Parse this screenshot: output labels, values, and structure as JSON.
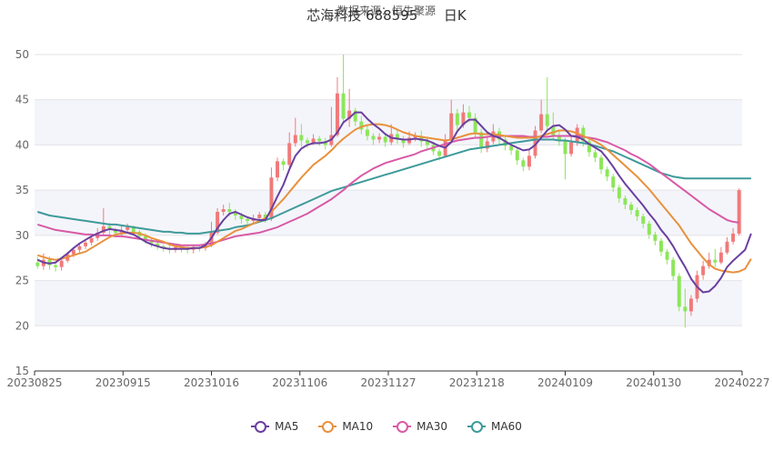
{
  "title": "芯海科技 688595      日K",
  "source": "数据来源：恒生聚源",
  "chart_data": {
    "type": "candlestick",
    "y_axis": {
      "min": 15,
      "max": 50,
      "ticks": [
        15,
        20,
        25,
        30,
        35,
        40,
        45,
        50
      ]
    },
    "x_tick_labels": [
      "20230825",
      "20230915",
      "20231016",
      "20231106",
      "20231127",
      "20231218",
      "20240109",
      "20240130",
      "20240227"
    ],
    "colors": {
      "up": "#f07a7a",
      "down": "#8ce65a",
      "ma5": "#6a3fa0",
      "ma10": "#e8913d",
      "ma30": "#d85aa6",
      "ma60": "#3e9a9a"
    },
    "candles": [
      [
        27.0,
        26.6,
        27.6,
        26.3
      ],
      [
        26.6,
        27.3,
        28.0,
        26.2
      ],
      [
        27.3,
        26.7,
        27.7,
        26.2
      ],
      [
        26.7,
        26.5,
        27.1,
        26.0
      ],
      [
        26.5,
        27.2,
        27.5,
        26.1
      ],
      [
        27.2,
        27.9,
        28.2,
        27.0
      ],
      [
        27.9,
        28.4,
        28.7,
        27.6
      ],
      [
        28.4,
        28.8,
        29.2,
        28.1
      ],
      [
        28.8,
        29.2,
        29.6,
        28.5
      ],
      [
        29.2,
        29.7,
        30.0,
        28.9
      ],
      [
        29.7,
        30.3,
        30.8,
        29.4
      ],
      [
        30.3,
        31.0,
        33.0,
        30.0
      ],
      [
        31.0,
        30.6,
        31.4,
        30.1
      ],
      [
        30.6,
        30.3,
        30.8,
        29.8
      ],
      [
        30.3,
        30.6,
        31.0,
        30.0
      ],
      [
        30.6,
        30.9,
        31.3,
        30.4
      ],
      [
        30.9,
        30.4,
        31.1,
        30.0
      ],
      [
        30.4,
        29.9,
        30.6,
        29.5
      ],
      [
        29.9,
        29.4,
        30.2,
        29.1
      ],
      [
        29.4,
        29.1,
        29.7,
        28.7
      ],
      [
        29.1,
        28.8,
        29.3,
        28.4
      ],
      [
        28.8,
        28.6,
        29.0,
        28.2
      ],
      [
        28.6,
        28.4,
        28.9,
        28.0
      ],
      [
        28.4,
        28.7,
        29.0,
        28.1
      ],
      [
        28.7,
        28.5,
        28.9,
        28.1
      ],
      [
        28.5,
        28.4,
        28.8,
        28.0
      ],
      [
        28.4,
        28.7,
        29.0,
        28.0
      ],
      [
        28.7,
        28.6,
        29.0,
        28.2
      ],
      [
        28.6,
        28.9,
        29.3,
        28.3
      ],
      [
        28.9,
        30.3,
        31.5,
        28.7
      ],
      [
        30.3,
        32.6,
        33.0,
        30.1
      ],
      [
        32.6,
        32.9,
        33.4,
        32.2
      ],
      [
        32.9,
        32.6,
        33.6,
        32.1
      ],
      [
        32.6,
        32.2,
        32.9,
        31.7
      ],
      [
        32.2,
        31.8,
        32.5,
        31.3
      ],
      [
        31.8,
        31.6,
        32.1,
        31.1
      ],
      [
        31.6,
        31.9,
        32.3,
        31.3
      ],
      [
        31.9,
        32.3,
        32.6,
        31.6
      ],
      [
        32.3,
        31.8,
        32.6,
        31.4
      ],
      [
        31.8,
        36.4,
        37.5,
        31.6
      ],
      [
        36.4,
        38.2,
        38.6,
        36.0
      ],
      [
        38.2,
        37.8,
        38.5,
        37.2
      ],
      [
        37.8,
        40.2,
        41.4,
        37.5
      ],
      [
        40.2,
        41.1,
        43.0,
        39.8
      ],
      [
        41.1,
        40.5,
        42.3,
        39.8
      ],
      [
        40.5,
        40.2,
        40.8,
        39.7
      ],
      [
        40.2,
        40.7,
        41.2,
        40.0
      ],
      [
        40.7,
        40.4,
        41.0,
        39.9
      ],
      [
        40.4,
        40.0,
        40.8,
        39.5
      ],
      [
        40.0,
        41.1,
        44.2,
        39.8
      ],
      [
        41.1,
        45.7,
        47.5,
        40.9
      ],
      [
        45.7,
        42.9,
        50.0,
        42.4
      ],
      [
        42.9,
        43.8,
        46.2,
        42.0
      ],
      [
        43.8,
        42.6,
        44.1,
        42.1
      ],
      [
        42.6,
        41.7,
        43.2,
        41.2
      ],
      [
        41.7,
        41.0,
        42.1,
        40.5
      ],
      [
        41.0,
        40.6,
        41.3,
        40.0
      ],
      [
        40.6,
        40.9,
        41.3,
        40.2
      ],
      [
        40.9,
        40.3,
        41.2,
        39.8
      ],
      [
        40.3,
        41.2,
        42.3,
        40.0
      ],
      [
        41.2,
        40.6,
        41.7,
        40.1
      ],
      [
        40.6,
        40.2,
        41.0,
        39.7
      ],
      [
        40.2,
        40.8,
        41.5,
        40.0
      ],
      [
        40.8,
        41.0,
        41.4,
        40.4
      ],
      [
        41.0,
        40.4,
        41.6,
        39.8
      ],
      [
        40.4,
        40.0,
        40.8,
        39.5
      ],
      [
        40.0,
        39.3,
        40.4,
        38.9
      ],
      [
        39.3,
        38.8,
        39.6,
        38.3
      ],
      [
        38.8,
        40.5,
        41.2,
        38.6
      ],
      [
        40.5,
        43.5,
        45.0,
        40.3
      ],
      [
        43.5,
        42.2,
        44.0,
        41.6
      ],
      [
        42.2,
        43.6,
        44.5,
        41.9
      ],
      [
        43.6,
        43.0,
        44.3,
        42.5
      ],
      [
        43.0,
        41.4,
        43.5,
        40.8
      ],
      [
        41.4,
        39.6,
        41.8,
        39.1
      ],
      [
        39.6,
        40.4,
        41.0,
        39.2
      ],
      [
        40.4,
        41.5,
        42.3,
        40.1
      ],
      [
        41.5,
        40.6,
        41.9,
        40.1
      ],
      [
        40.6,
        39.9,
        41.0,
        39.4
      ],
      [
        39.9,
        39.4,
        40.3,
        38.9
      ],
      [
        39.4,
        38.3,
        39.7,
        37.8
      ],
      [
        38.3,
        37.6,
        38.6,
        37.1
      ],
      [
        37.6,
        38.8,
        39.4,
        37.2
      ],
      [
        38.8,
        41.6,
        42.1,
        38.5
      ],
      [
        41.6,
        43.4,
        45.0,
        41.3
      ],
      [
        43.4,
        42.1,
        47.5,
        41.6
      ],
      [
        42.1,
        41.0,
        43.6,
        40.5
      ],
      [
        41.0,
        40.5,
        41.5,
        39.9
      ],
      [
        40.5,
        39.0,
        40.8,
        36.2
      ],
      [
        39.0,
        40.3,
        40.9,
        38.7
      ],
      [
        40.3,
        41.9,
        42.3,
        39.9
      ],
      [
        41.9,
        40.4,
        42.2,
        39.8
      ],
      [
        40.4,
        39.2,
        40.7,
        38.7
      ],
      [
        39.2,
        38.6,
        39.5,
        38.1
      ],
      [
        38.6,
        37.3,
        38.9,
        36.8
      ],
      [
        37.3,
        36.5,
        37.6,
        36.0
      ],
      [
        36.5,
        35.3,
        36.8,
        34.8
      ],
      [
        35.3,
        34.1,
        35.6,
        33.6
      ],
      [
        34.1,
        33.4,
        34.4,
        32.9
      ],
      [
        33.4,
        32.8,
        33.7,
        32.3
      ],
      [
        32.8,
        32.1,
        33.1,
        31.6
      ],
      [
        32.1,
        31.3,
        32.4,
        30.8
      ],
      [
        31.3,
        30.1,
        31.6,
        29.6
      ],
      [
        30.1,
        29.4,
        30.4,
        28.9
      ],
      [
        29.4,
        28.2,
        29.7,
        27.7
      ],
      [
        28.2,
        27.3,
        28.5,
        26.8
      ],
      [
        27.3,
        25.5,
        27.6,
        25.0
      ],
      [
        25.5,
        22.1,
        25.8,
        21.6
      ],
      [
        22.1,
        21.6,
        24.1,
        19.8
      ],
      [
        21.6,
        23.0,
        23.4,
        21.1
      ],
      [
        23.0,
        25.6,
        26.1,
        22.6
      ],
      [
        25.6,
        26.6,
        27.2,
        25.1
      ],
      [
        26.6,
        27.3,
        28.1,
        26.3
      ],
      [
        27.3,
        27.0,
        28.5,
        26.5
      ],
      [
        27.0,
        28.1,
        28.7,
        26.8
      ],
      [
        28.1,
        29.3,
        29.8,
        27.9
      ],
      [
        29.3,
        30.2,
        30.8,
        29.0
      ],
      [
        30.2,
        35.0,
        35.2,
        30.0
      ]
    ],
    "ma5": [
      27.3,
      27.0,
      26.9,
      27.0,
      27.5,
      28.0,
      28.6,
      29.1,
      29.5,
      29.9,
      30.2,
      30.5,
      30.7,
      30.6,
      30.5,
      30.3,
      30.1,
      29.7,
      29.3,
      29.0,
      28.8,
      28.6,
      28.5,
      28.5,
      28.5,
      28.5,
      28.6,
      28.6,
      28.9,
      29.7,
      30.8,
      31.7,
      32.4,
      32.6,
      32.3,
      32.0,
      31.8,
      31.7,
      31.7,
      32.9,
      34.3,
      35.6,
      37.3,
      38.8,
      39.6,
      40.0,
      40.2,
      40.2,
      40.3,
      40.6,
      41.4,
      42.5,
      43.0,
      43.6,
      43.6,
      42.9,
      42.3,
      41.8,
      41.2,
      40.8,
      40.7,
      40.6,
      40.6,
      40.7,
      40.6,
      40.5,
      40.2,
      39.9,
      39.7,
      40.3,
      41.5,
      42.3,
      42.8,
      42.8,
      42.1,
      41.4,
      41.0,
      40.8,
      40.4,
      40.0,
      39.7,
      39.4,
      39.5,
      40.0,
      40.8,
      41.6,
      42.1,
      42.2,
      41.7,
      41.0,
      40.9,
      40.6,
      40.1,
      39.7,
      39.3,
      38.5,
      37.6,
      36.6,
      35.7,
      34.9,
      34.1,
      33.3,
      32.4,
      31.6,
      30.6,
      29.8,
      28.8,
      27.6,
      26.5,
      25.2,
      24.3,
      23.7,
      23.8,
      24.4,
      25.3,
      26.5,
      27.2,
      27.8,
      28.4,
      30.2
    ],
    "ma10": [
      27.8,
      27.6,
      27.4,
      27.3,
      27.4,
      27.6,
      27.8,
      28.0,
      28.2,
      28.6,
      29.0,
      29.4,
      29.8,
      30.1,
      30.2,
      30.3,
      30.3,
      30.2,
      30.0,
      29.7,
      29.5,
      29.3,
      29.0,
      28.8,
      28.7,
      28.6,
      28.6,
      28.6,
      28.7,
      28.9,
      29.3,
      29.7,
      30.1,
      30.5,
      30.7,
      31.0,
      31.3,
      31.6,
      31.9,
      32.6,
      33.3,
      34.0,
      34.8,
      35.6,
      36.4,
      37.1,
      37.8,
      38.3,
      38.8,
      39.4,
      40.1,
      40.7,
      41.2,
      41.7,
      42.0,
      42.2,
      42.3,
      42.3,
      42.2,
      42.0,
      41.7,
      41.4,
      41.2,
      41.0,
      40.9,
      40.8,
      40.7,
      40.6,
      40.5,
      40.6,
      40.8,
      41.0,
      41.2,
      41.3,
      41.2,
      41.2,
      41.2,
      41.1,
      41.0,
      40.9,
      40.8,
      40.8,
      40.8,
      40.8,
      41.0,
      41.2,
      41.4,
      41.6,
      41.6,
      41.5,
      41.3,
      41.0,
      40.7,
      40.4,
      40.0,
      39.5,
      38.9,
      38.3,
      37.7,
      37.1,
      36.5,
      35.8,
      35.1,
      34.3,
      33.5,
      32.7,
      31.9,
      31.1,
      30.1,
      29.1,
      28.3,
      27.5,
      26.8,
      26.3,
      26.1,
      26.0,
      25.9,
      26.0,
      26.3,
      27.4
    ],
    "ma30": [
      31.2,
      31.0,
      30.8,
      30.6,
      30.5,
      30.4,
      30.3,
      30.2,
      30.1,
      30.1,
      30.0,
      30.0,
      30.0,
      29.9,
      29.9,
      29.8,
      29.7,
      29.6,
      29.5,
      29.4,
      29.3,
      29.2,
      29.1,
      29.0,
      28.9,
      28.9,
      28.9,
      28.9,
      29.0,
      29.1,
      29.3,
      29.5,
      29.7,
      29.9,
      30.0,
      30.1,
      30.2,
      30.3,
      30.5,
      30.7,
      30.9,
      31.2,
      31.5,
      31.8,
      32.1,
      32.4,
      32.8,
      33.2,
      33.6,
      34.0,
      34.5,
      35.0,
      35.6,
      36.1,
      36.6,
      37.0,
      37.4,
      37.7,
      38.0,
      38.2,
      38.4,
      38.6,
      38.8,
      39.0,
      39.3,
      39.5,
      39.7,
      39.9,
      40.1,
      40.3,
      40.5,
      40.6,
      40.7,
      40.8,
      40.8,
      40.9,
      41.0,
      41.0,
      41.0,
      41.0,
      41.0,
      41.0,
      40.9,
      40.9,
      40.9,
      40.9,
      41.0,
      41.0,
      41.0,
      41.0,
      41.0,
      40.9,
      40.8,
      40.7,
      40.5,
      40.3,
      40.0,
      39.7,
      39.4,
      39.0,
      38.7,
      38.3,
      37.9,
      37.4,
      36.9,
      36.4,
      35.9,
      35.4,
      34.9,
      34.4,
      33.9,
      33.4,
      32.9,
      32.5,
      32.1,
      31.7,
      31.5,
      31.4
    ],
    "ma60": [
      32.6,
      32.4,
      32.2,
      32.1,
      32.0,
      31.9,
      31.8,
      31.7,
      31.6,
      31.5,
      31.4,
      31.3,
      31.2,
      31.2,
      31.1,
      31.0,
      30.9,
      30.8,
      30.7,
      30.6,
      30.5,
      30.4,
      30.4,
      30.3,
      30.3,
      30.2,
      30.2,
      30.2,
      30.3,
      30.4,
      30.5,
      30.6,
      30.7,
      30.9,
      31.0,
      31.1,
      31.3,
      31.5,
      31.7,
      31.9,
      32.2,
      32.5,
      32.8,
      33.1,
      33.4,
      33.7,
      34.0,
      34.3,
      34.6,
      34.9,
      35.1,
      35.3,
      35.5,
      35.7,
      35.9,
      36.1,
      36.3,
      36.5,
      36.7,
      36.9,
      37.1,
      37.3,
      37.5,
      37.7,
      37.9,
      38.1,
      38.3,
      38.5,
      38.7,
      38.9,
      39.1,
      39.3,
      39.5,
      39.6,
      39.7,
      39.8,
      39.9,
      40.0,
      40.1,
      40.2,
      40.3,
      40.4,
      40.5,
      40.6,
      40.6,
      40.6,
      40.6,
      40.5,
      40.5,
      40.4,
      40.3,
      40.2,
      40.1,
      39.9,
      39.7,
      39.5,
      39.3,
      39.0,
      38.7,
      38.4,
      38.1,
      37.8,
      37.5,
      37.2,
      36.9,
      36.7,
      36.5,
      36.4,
      36.3,
      36.3,
      36.3,
      36.3,
      36.3,
      36.3,
      36.3,
      36.3,
      36.3,
      36.3,
      36.3,
      36.3
    ],
    "legend": [
      "MA5",
      "MA10",
      "MA30",
      "MA60"
    ]
  }
}
